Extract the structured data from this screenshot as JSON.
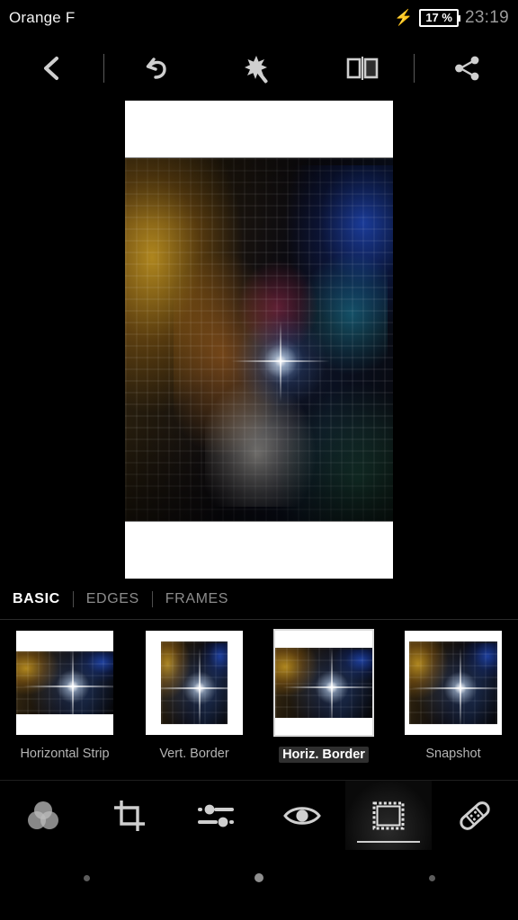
{
  "status_bar": {
    "carrier": "Orange F",
    "charging_icon": "charging-bolt-icon",
    "battery_text": "17 %",
    "clock": "23:19"
  },
  "toolbar": {
    "back_label": "back-chevron-icon",
    "undo_label": "undo-icon",
    "auto_enhance_label": "magic-wand-icon",
    "compare_label": "compare-before-after-icon",
    "share_label": "share-icon"
  },
  "canvas": {
    "effect_applied": "Horiz. Border",
    "image_description": "Wall of mounted butterflies with bright light flare"
  },
  "tabs": [
    {
      "label": "BASIC",
      "active": true
    },
    {
      "label": "EDGES",
      "active": false
    },
    {
      "label": "FRAMES",
      "active": false
    }
  ],
  "presets": [
    {
      "label": "Horizontal Strip",
      "selected": false
    },
    {
      "label": "Vert. Border",
      "selected": false
    },
    {
      "label": "Horiz. Border",
      "selected": true
    },
    {
      "label": "Snapshot",
      "selected": false
    }
  ],
  "tools": [
    {
      "name": "filters",
      "icon": "three-circles-icon",
      "active": false
    },
    {
      "name": "crop",
      "icon": "crop-icon",
      "active": false
    },
    {
      "name": "adjust",
      "icon": "sliders-icon",
      "active": false
    },
    {
      "name": "effects",
      "icon": "eye-icon",
      "active": false
    },
    {
      "name": "frames",
      "icon": "stamp-frame-icon",
      "active": true
    },
    {
      "name": "heal",
      "icon": "bandage-icon",
      "active": false
    }
  ],
  "navigation": {
    "back": "nav-dot-back",
    "home": "nav-dot-home",
    "recents": "nav-dot-recents"
  },
  "colors": {
    "background": "#000000",
    "icon": "#cfcfcf",
    "inactive_text": "#8c8c8c",
    "active_text": "#ffffff",
    "clock": "#9a9a9a"
  }
}
